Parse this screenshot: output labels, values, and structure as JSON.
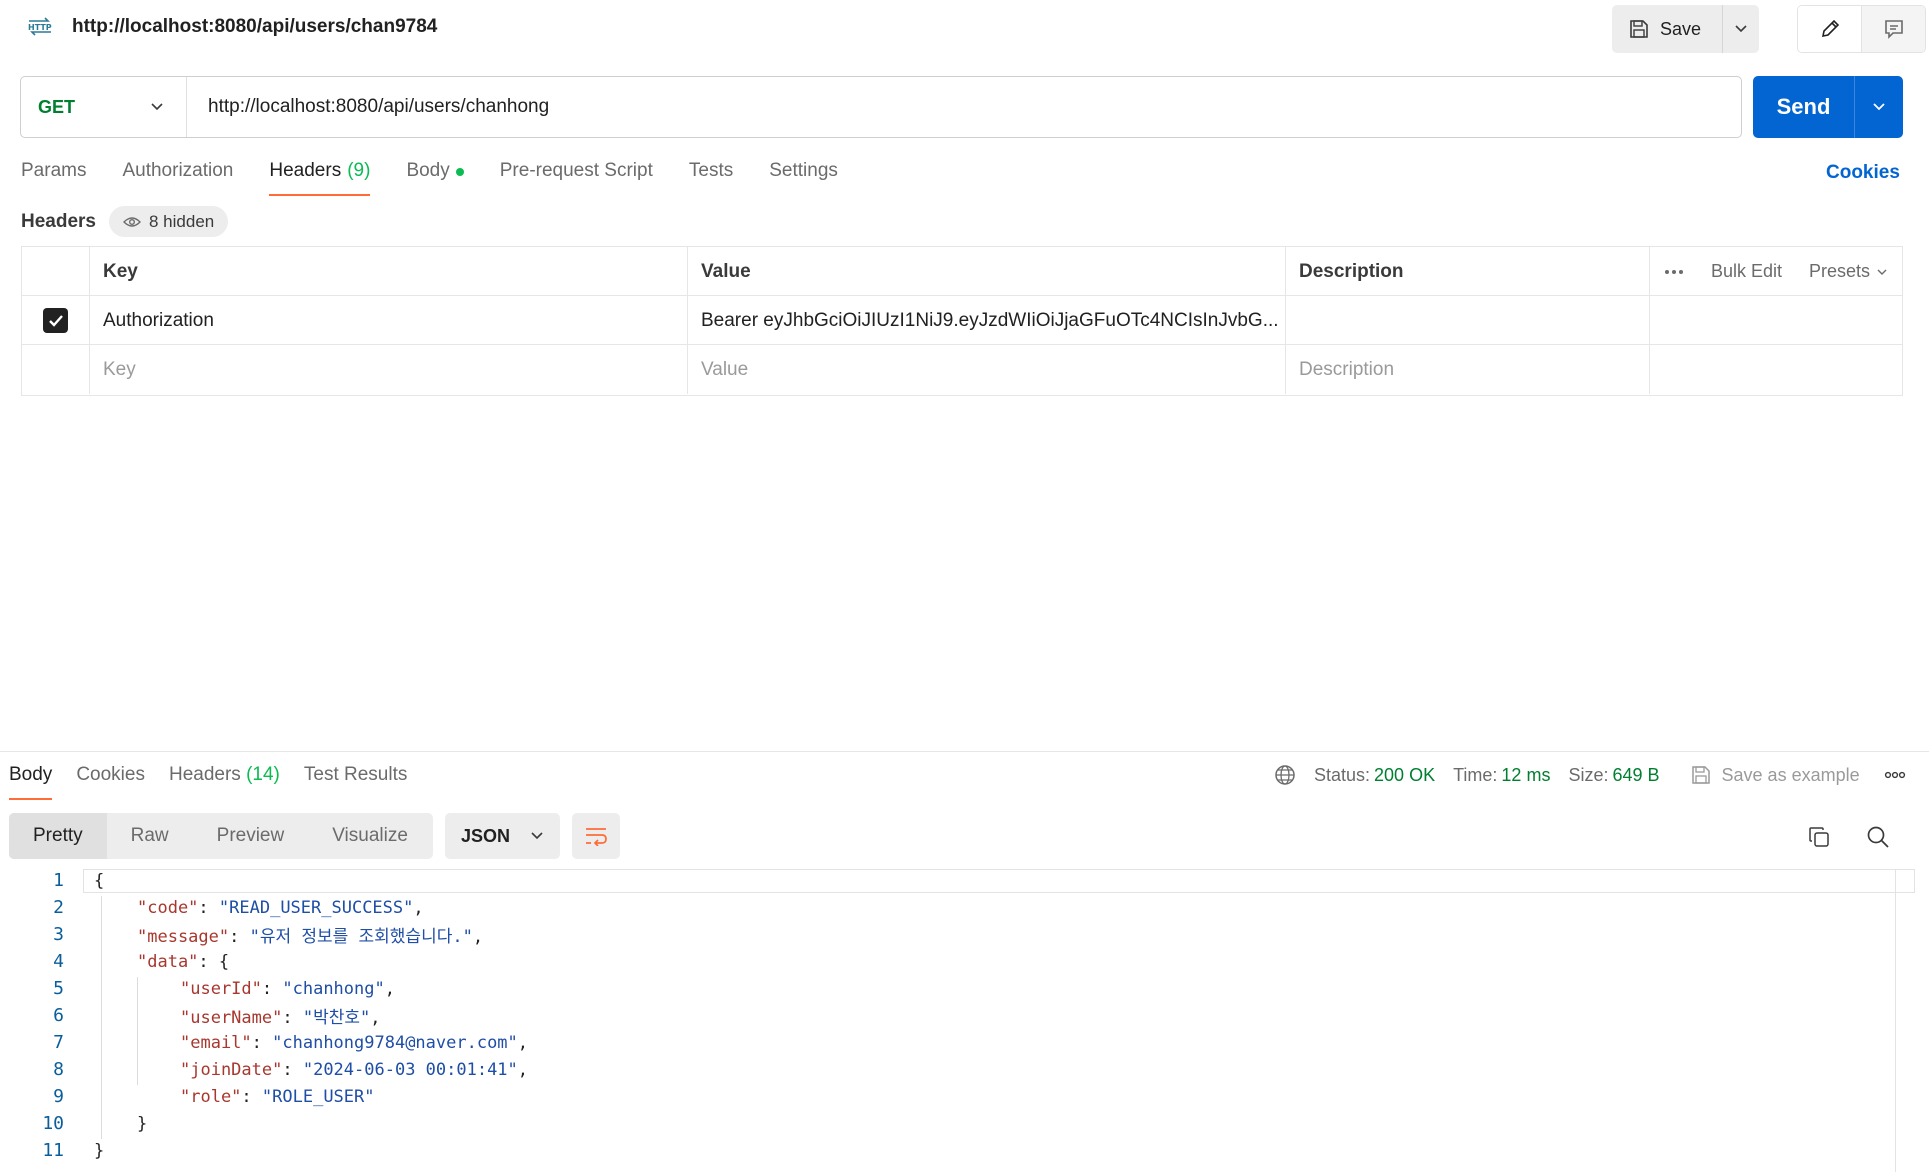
{
  "header": {
    "icon": "http-icon",
    "title": "http://localhost:8080/api/users/chan9784",
    "save_label": "Save"
  },
  "request": {
    "method": "GET",
    "url": "http://localhost:8080/api/users/chanhong",
    "send_label": "Send",
    "tabs": [
      {
        "label": "Params"
      },
      {
        "label": "Authorization"
      },
      {
        "label": "Headers",
        "count": "(9)"
      },
      {
        "label": "Body"
      },
      {
        "label": "Pre-request Script"
      },
      {
        "label": "Tests"
      },
      {
        "label": "Settings"
      }
    ],
    "cookies_label": "Cookies"
  },
  "headers_section": {
    "title": "Headers",
    "hidden_label": "8 hidden",
    "columns": {
      "key": "Key",
      "value": "Value",
      "description": "Description"
    },
    "bulk_edit": "Bulk Edit",
    "presets": "Presets",
    "rows": [
      {
        "key": "Authorization",
        "value": "Bearer eyJhbGciOiJIUzI1NiJ9.eyJzdWIiOiJjaGFuOTc4NCIsInJvbG...",
        "description": "",
        "checked": true
      }
    ],
    "placeholders": {
      "key": "Key",
      "value": "Value",
      "description": "Description"
    }
  },
  "response": {
    "tabs": [
      {
        "label": "Body"
      },
      {
        "label": "Cookies"
      },
      {
        "label": "Headers",
        "count": "(14)"
      },
      {
        "label": "Test Results"
      }
    ],
    "status_label": "Status:",
    "status_value": "200 OK",
    "time_label": "Time:",
    "time_value": "12 ms",
    "size_label": "Size:",
    "size_value": "649 B",
    "save_example": "Save as example",
    "views": [
      "Pretty",
      "Raw",
      "Preview",
      "Visualize"
    ],
    "format": "JSON",
    "lines": [
      {
        "n": "1",
        "text": "{"
      },
      {
        "n": "2",
        "key": "\"code\"",
        "value": "\"READ_USER_SUCCESS\"",
        "tail": ","
      },
      {
        "n": "3",
        "key": "\"message\"",
        "value": "\"유저 정보를 조회했습니다.\"",
        "tail": ","
      },
      {
        "n": "4",
        "key": "\"data\"",
        "value": "",
        "tail": "{"
      },
      {
        "n": "5",
        "key": "\"userId\"",
        "value": "\"chanhong\"",
        "tail": ","
      },
      {
        "n": "6",
        "key": "\"userName\"",
        "value": "\"박찬호\"",
        "tail": ","
      },
      {
        "n": "7",
        "key": "\"email\"",
        "value": "\"chanhong9784@naver.com\"",
        "tail": ","
      },
      {
        "n": "8",
        "key": "\"joinDate\"",
        "value": "\"2024-06-03 00:01:41\"",
        "tail": ","
      },
      {
        "n": "9",
        "key": "\"role\"",
        "value": "\"ROLE_USER\"",
        "tail": ""
      },
      {
        "n": "10",
        "text": "}"
      },
      {
        "n": "11",
        "text": "}"
      }
    ]
  },
  "colors": {
    "accent": "#ff6c37",
    "send": "#0265d2",
    "method": "#007f31",
    "json_key": "#a8372e",
    "json_string": "#1f4ea6"
  }
}
